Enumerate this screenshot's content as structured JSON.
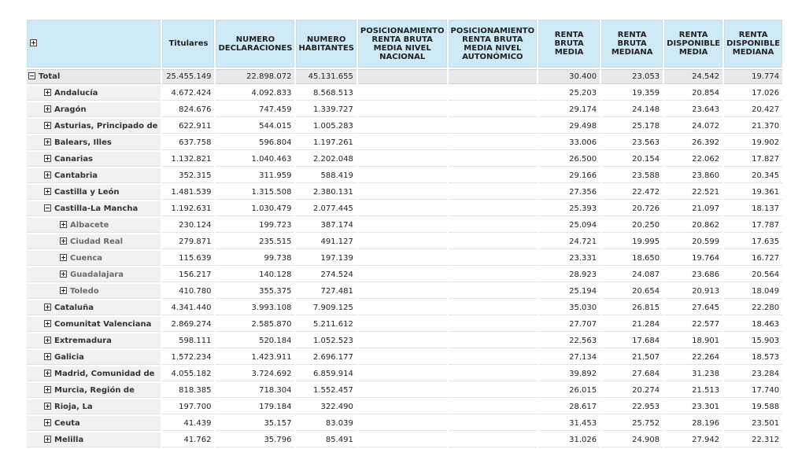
{
  "columns": [
    "Titulares",
    "NUMERO DECLARACIONES",
    "NUMERO HABITANTES",
    "POSICIONAMIENTO RENTA BRUTA MEDIA NIVEL NACIONAL",
    "POSICIONAMIENTO RENTA BRUTA MEDIA NIVEL AUTONÓMICO",
    "RENTA BRUTA MEDIA",
    "RENTA BRUTA MEDIANA",
    "RENTA DISPONIBLE MEDIA",
    "RENTA DISPONIBLE MEDIANA"
  ],
  "rows": [
    {
      "label": "Total",
      "level": 0,
      "expanded": true,
      "values": [
        "25.455.149",
        "22.898.072",
        "45.131.655",
        "",
        "",
        "30.400",
        "23.053",
        "24.542",
        "19.774"
      ]
    },
    {
      "label": "Andalucía",
      "level": 1,
      "expanded": false,
      "values": [
        "4.672.424",
        "4.092.833",
        "8.568.513",
        "",
        "",
        "25.203",
        "19.359",
        "20.854",
        "17.026"
      ]
    },
    {
      "label": "Aragón",
      "level": 1,
      "expanded": false,
      "values": [
        "824.676",
        "747.459",
        "1.339.727",
        "",
        "",
        "29.174",
        "24.148",
        "23.643",
        "20.427"
      ]
    },
    {
      "label": "Asturias, Principado de",
      "level": 1,
      "expanded": false,
      "values": [
        "622.911",
        "544.015",
        "1.005.283",
        "",
        "",
        "29.498",
        "25.178",
        "24.072",
        "21.370"
      ]
    },
    {
      "label": "Balears, Illes",
      "level": 1,
      "expanded": false,
      "values": [
        "637.758",
        "596.804",
        "1.197.261",
        "",
        "",
        "33.006",
        "23.563",
        "26.392",
        "19.902"
      ]
    },
    {
      "label": "Canarias",
      "level": 1,
      "expanded": false,
      "values": [
        "1.132.821",
        "1.040.463",
        "2.202.048",
        "",
        "",
        "26.500",
        "20.154",
        "22.062",
        "17.827"
      ]
    },
    {
      "label": "Cantabria",
      "level": 1,
      "expanded": false,
      "values": [
        "352.315",
        "311.959",
        "588.419",
        "",
        "",
        "29.166",
        "23.588",
        "23.860",
        "20.345"
      ]
    },
    {
      "label": "Castilla y León",
      "level": 1,
      "expanded": false,
      "values": [
        "1.481.539",
        "1.315.508",
        "2.380.131",
        "",
        "",
        "27.356",
        "22.472",
        "22.521",
        "19.361"
      ]
    },
    {
      "label": "Castilla-La Mancha",
      "level": 1,
      "expanded": true,
      "values": [
        "1.192.631",
        "1.030.479",
        "2.077.445",
        "",
        "",
        "25.393",
        "20.726",
        "21.097",
        "18.137"
      ]
    },
    {
      "label": "Albacete",
      "level": 2,
      "expanded": false,
      "values": [
        "230.124",
        "199.723",
        "387.174",
        "",
        "",
        "25.094",
        "20.250",
        "20.862",
        "17.787"
      ]
    },
    {
      "label": "Ciudad Real",
      "level": 2,
      "expanded": false,
      "values": [
        "279.871",
        "235.515",
        "491.127",
        "",
        "",
        "24.721",
        "19.995",
        "20.599",
        "17.635"
      ]
    },
    {
      "label": "Cuenca",
      "level": 2,
      "expanded": false,
      "values": [
        "115.639",
        "99.738",
        "197.139",
        "",
        "",
        "23.331",
        "18.650",
        "19.764",
        "16.727"
      ]
    },
    {
      "label": "Guadalajara",
      "level": 2,
      "expanded": false,
      "values": [
        "156.217",
        "140.128",
        "274.524",
        "",
        "",
        "28.923",
        "24.087",
        "23.686",
        "20.564"
      ]
    },
    {
      "label": "Toledo",
      "level": 2,
      "expanded": false,
      "values": [
        "410.780",
        "355.375",
        "727.481",
        "",
        "",
        "25.194",
        "20.654",
        "20.913",
        "18.049"
      ]
    },
    {
      "label": "Cataluña",
      "level": 1,
      "expanded": false,
      "values": [
        "4.341.440",
        "3.993.108",
        "7.909.125",
        "",
        "",
        "35.030",
        "26.815",
        "27.645",
        "22.280"
      ]
    },
    {
      "label": "Comunitat Valenciana",
      "level": 1,
      "expanded": false,
      "values": [
        "2.869.274",
        "2.585.870",
        "5.211.612",
        "",
        "",
        "27.707",
        "21.284",
        "22.577",
        "18.463"
      ]
    },
    {
      "label": "Extremadura",
      "level": 1,
      "expanded": false,
      "values": [
        "598.111",
        "520.184",
        "1.052.523",
        "",
        "",
        "22.563",
        "17.684",
        "18.901",
        "15.903"
      ]
    },
    {
      "label": "Galicia",
      "level": 1,
      "expanded": false,
      "values": [
        "1.572.234",
        "1.423.911",
        "2.696.177",
        "",
        "",
        "27.134",
        "21.507",
        "22.264",
        "18.573"
      ]
    },
    {
      "label": "Madrid, Comunidad de",
      "level": 1,
      "expanded": false,
      "values": [
        "4.055.182",
        "3.724.692",
        "6.859.914",
        "",
        "",
        "39.892",
        "27.684",
        "31.238",
        "23.284"
      ]
    },
    {
      "label": "Murcia, Región de",
      "level": 1,
      "expanded": false,
      "values": [
        "818.385",
        "718.304",
        "1.552.457",
        "",
        "",
        "26.015",
        "20.274",
        "21.513",
        "17.740"
      ]
    },
    {
      "label": "Rioja, La",
      "level": 1,
      "expanded": false,
      "values": [
        "197.700",
        "179.184",
        "322.490",
        "",
        "",
        "28.617",
        "22.953",
        "23.301",
        "19.588"
      ]
    },
    {
      "label": "Ceuta",
      "level": 1,
      "expanded": false,
      "values": [
        "41.439",
        "35.157",
        "83.039",
        "",
        "",
        "31.453",
        "25.752",
        "28.196",
        "23.501"
      ]
    },
    {
      "label": "Melilla",
      "level": 1,
      "expanded": false,
      "values": [
        "41.762",
        "35.796",
        "85.491",
        "",
        "",
        "31.026",
        "24.908",
        "27.942",
        "22.312"
      ]
    }
  ]
}
